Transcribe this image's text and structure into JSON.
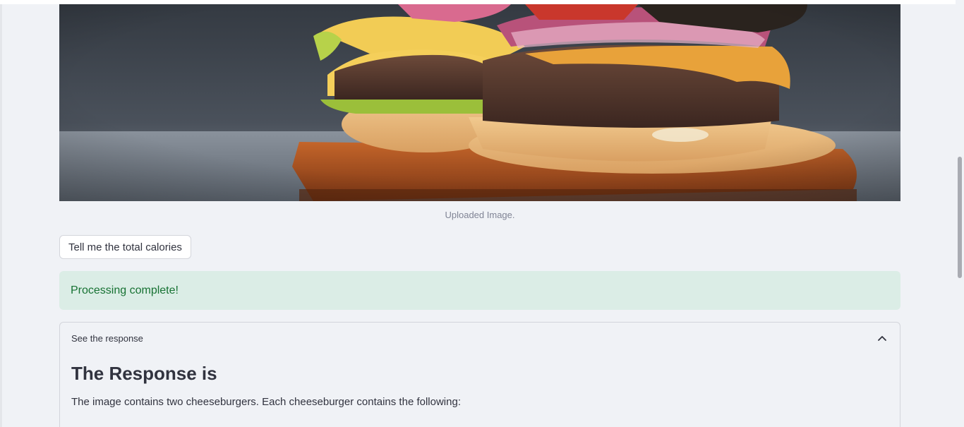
{
  "image": {
    "caption": "Uploaded Image."
  },
  "actions": {
    "calories_button_label": "Tell me the total calories"
  },
  "alert": {
    "message": "Processing complete!",
    "color": "#177233",
    "background": "#dbede6"
  },
  "expander": {
    "header_label": "See the response",
    "expanded": true,
    "icon": "chevron-up-icon",
    "title": "The Response is",
    "text": "The image contains two cheeseburgers. Each cheeseburger contains the following:"
  }
}
